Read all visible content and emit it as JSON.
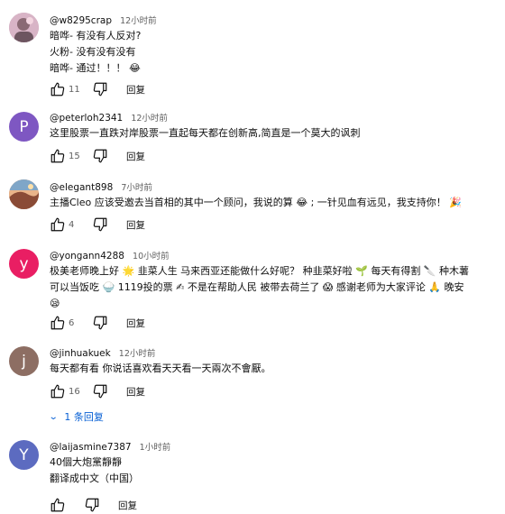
{
  "comments": [
    {
      "handle": "@w8295crap",
      "time": "12小时前",
      "lines": [
        "暗哗- 有没有人反对?",
        "火粉- 没有没有没有",
        "暗哗- 通过！！！ 😂"
      ],
      "likes": "11",
      "reply": "回复",
      "avatar_type": "image",
      "avatar_color": "#c9a6b8"
    },
    {
      "handle": "@peterloh2341",
      "time": "12小时前",
      "lines": [
        "这里股票一直跌对岸股票一直起每天都在创新高,简直是一个莫大的讽刺"
      ],
      "likes": "15",
      "reply": "回复",
      "avatar_letter": "P",
      "avatar_color": "#7e57c2"
    },
    {
      "handle": "@elegant898",
      "time": "7小时前",
      "lines": [
        "主播Cleo 应该受邀去当首相的其中一个顾问，我说的算 😂 ; 一针见血有远见，我支持你！ 🎉"
      ],
      "likes": "4",
      "reply": "回复",
      "avatar_type": "image",
      "avatar_color": "#b07a5a"
    },
    {
      "handle": "@yongann4288",
      "time": "10小时前",
      "lines": [
        "极美老师晚上好 🌟 韭菜人生  马来西亚还能做什么好呢？  种韭菜好啦 🌱 每天有得割 🔪  种木薯",
        "可以当饭吃 🍚  1119投的票 ✍  不是在帮助人民  被带去荷兰了 😱 感谢老师为大家评论 🙏 晚安",
        "😪"
      ],
      "likes": "6",
      "reply": "回复",
      "avatar_letter": "y",
      "avatar_color": "#e91e63"
    },
    {
      "handle": "@jinhuakuek",
      "time": "12小时前",
      "lines": [
        "每天都有看 你说话喜欢看天天看一天兩次不會厭。"
      ],
      "likes": "16",
      "reply": "回复",
      "avatar_letter": "j",
      "avatar_color": "#8d6e63",
      "replies_label": "1 条回复"
    },
    {
      "handle": "@laijasmine7387",
      "time": "1小时前",
      "lines": [
        "40個大炮黨靜靜",
        "翻译成中文（中国）"
      ],
      "reply": "回复",
      "avatar_letter": "Y",
      "avatar_color": "#5c6bc0"
    }
  ],
  "icons": {
    "like": "thumb-up-icon",
    "dislike": "thumb-down-icon",
    "chevron": "chevron-down-icon"
  }
}
